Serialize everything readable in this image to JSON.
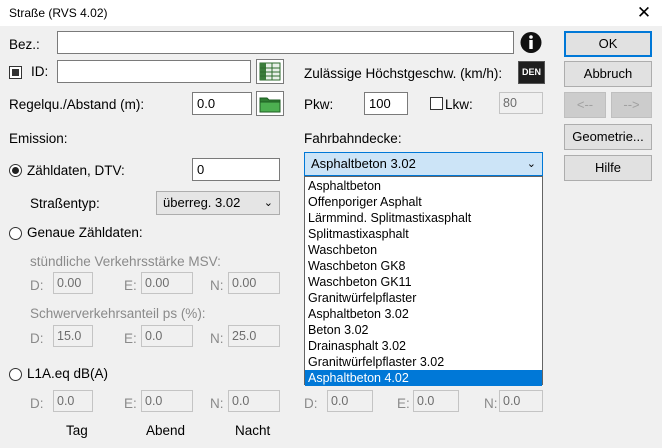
{
  "window": {
    "title": "Straße (RVS 4.02)",
    "close": "✕"
  },
  "labels": {
    "bez": "Bez.:",
    "id": "ID:",
    "regelqu": "Regelqu./Abstand (m):",
    "emission": "Emission:",
    "zaehldaten": "Zähldaten, DTV:",
    "strassentyp": "Straßentyp:",
    "genaue": "Genaue Zähldaten:",
    "msv": "stündliche Verkehrsstärke MSV:",
    "schwer": "Schwerverkehrsanteil ps (%):",
    "l1a": "L1A.eq dB(A)",
    "d": "D:",
    "e": "E:",
    "n": "N:",
    "tag": "Tag",
    "abend": "Abend",
    "nacht": "Nacht",
    "zul": "Zulässige Höchstgeschw. (km/h):",
    "pkw": "Pkw:",
    "lkw": "Lkw:",
    "fahrbahn": "Fahrbahndecke:"
  },
  "fields": {
    "bez": "",
    "id": "",
    "regelqu": "0.0",
    "dtv": "0",
    "strassentyp": "überreg. 3.02",
    "msv": {
      "d": "0.00",
      "e": "0.00",
      "n": "0.00"
    },
    "ps": {
      "d": "15.0",
      "e": "0.0",
      "n": "25.0"
    },
    "l1a": {
      "d": "0.0",
      "e": "0.0",
      "n": "0.0"
    },
    "l1a_right": {
      "d": "0.0",
      "e": "0.0",
      "n": "0.0"
    },
    "pkw": "100",
    "lkw": "80",
    "fahrbahn": "Asphaltbeton 3.02"
  },
  "dropdown_items": [
    "Asphaltbeton",
    "Offenporiger Asphalt",
    "Lärmmind. Splitmastixasphalt",
    "Splitmastixasphalt",
    "Waschbeton",
    "Waschbeton GK8",
    "Waschbeton GK11",
    "Granitwürfelpflaster",
    "Asphaltbeton 3.02",
    "Beton 3.02",
    "Drainasphalt 3.02",
    "Granitwürfelpflaster 3.02",
    "Asphaltbeton 4.02"
  ],
  "dropdown_highlighted": 12,
  "buttons": {
    "ok": "OK",
    "abbruch": "Abbruch",
    "prev": "<--",
    "next": "-->",
    "geometrie": "Geometrie...",
    "hilfe": "Hilfe",
    "den": "DEN",
    "info": "i"
  },
  "state": {
    "id_checked": true,
    "lkw_checked": false,
    "radio_selected": "zaehldaten"
  }
}
